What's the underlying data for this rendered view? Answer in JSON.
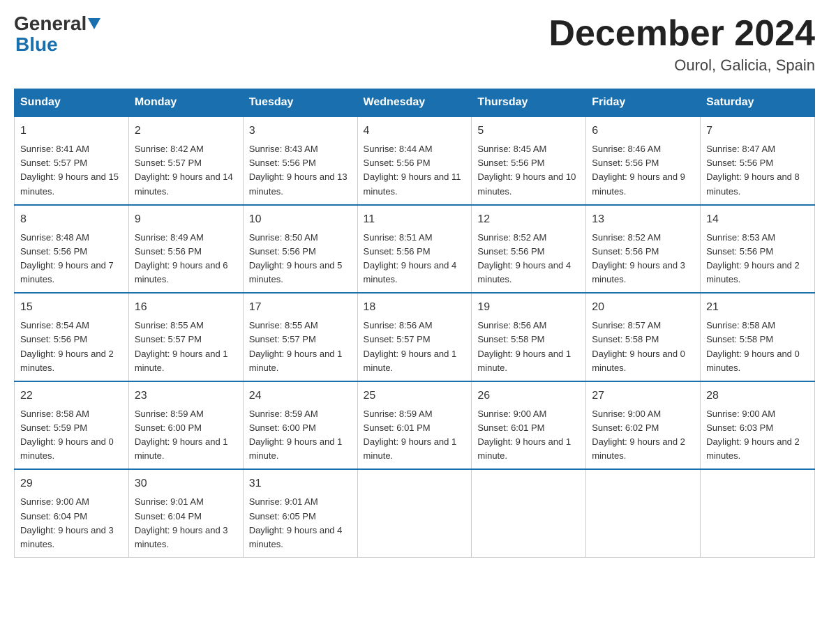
{
  "header": {
    "logo_general": "General",
    "logo_blue": "Blue",
    "month_title": "December 2024",
    "location": "Ourol, Galicia, Spain"
  },
  "weekdays": [
    "Sunday",
    "Monday",
    "Tuesday",
    "Wednesday",
    "Thursday",
    "Friday",
    "Saturday"
  ],
  "weeks": [
    [
      {
        "day": "1",
        "sunrise": "8:41 AM",
        "sunset": "5:57 PM",
        "daylight": "9 hours and 15 minutes."
      },
      {
        "day": "2",
        "sunrise": "8:42 AM",
        "sunset": "5:57 PM",
        "daylight": "9 hours and 14 minutes."
      },
      {
        "day": "3",
        "sunrise": "8:43 AM",
        "sunset": "5:56 PM",
        "daylight": "9 hours and 13 minutes."
      },
      {
        "day": "4",
        "sunrise": "8:44 AM",
        "sunset": "5:56 PM",
        "daylight": "9 hours and 11 minutes."
      },
      {
        "day": "5",
        "sunrise": "8:45 AM",
        "sunset": "5:56 PM",
        "daylight": "9 hours and 10 minutes."
      },
      {
        "day": "6",
        "sunrise": "8:46 AM",
        "sunset": "5:56 PM",
        "daylight": "9 hours and 9 minutes."
      },
      {
        "day": "7",
        "sunrise": "8:47 AM",
        "sunset": "5:56 PM",
        "daylight": "9 hours and 8 minutes."
      }
    ],
    [
      {
        "day": "8",
        "sunrise": "8:48 AM",
        "sunset": "5:56 PM",
        "daylight": "9 hours and 7 minutes."
      },
      {
        "day": "9",
        "sunrise": "8:49 AM",
        "sunset": "5:56 PM",
        "daylight": "9 hours and 6 minutes."
      },
      {
        "day": "10",
        "sunrise": "8:50 AM",
        "sunset": "5:56 PM",
        "daylight": "9 hours and 5 minutes."
      },
      {
        "day": "11",
        "sunrise": "8:51 AM",
        "sunset": "5:56 PM",
        "daylight": "9 hours and 4 minutes."
      },
      {
        "day": "12",
        "sunrise": "8:52 AM",
        "sunset": "5:56 PM",
        "daylight": "9 hours and 4 minutes."
      },
      {
        "day": "13",
        "sunrise": "8:52 AM",
        "sunset": "5:56 PM",
        "daylight": "9 hours and 3 minutes."
      },
      {
        "day": "14",
        "sunrise": "8:53 AM",
        "sunset": "5:56 PM",
        "daylight": "9 hours and 2 minutes."
      }
    ],
    [
      {
        "day": "15",
        "sunrise": "8:54 AM",
        "sunset": "5:56 PM",
        "daylight": "9 hours and 2 minutes."
      },
      {
        "day": "16",
        "sunrise": "8:55 AM",
        "sunset": "5:57 PM",
        "daylight": "9 hours and 1 minute."
      },
      {
        "day": "17",
        "sunrise": "8:55 AM",
        "sunset": "5:57 PM",
        "daylight": "9 hours and 1 minute."
      },
      {
        "day": "18",
        "sunrise": "8:56 AM",
        "sunset": "5:57 PM",
        "daylight": "9 hours and 1 minute."
      },
      {
        "day": "19",
        "sunrise": "8:56 AM",
        "sunset": "5:58 PM",
        "daylight": "9 hours and 1 minute."
      },
      {
        "day": "20",
        "sunrise": "8:57 AM",
        "sunset": "5:58 PM",
        "daylight": "9 hours and 0 minutes."
      },
      {
        "day": "21",
        "sunrise": "8:58 AM",
        "sunset": "5:58 PM",
        "daylight": "9 hours and 0 minutes."
      }
    ],
    [
      {
        "day": "22",
        "sunrise": "8:58 AM",
        "sunset": "5:59 PM",
        "daylight": "9 hours and 0 minutes."
      },
      {
        "day": "23",
        "sunrise": "8:59 AM",
        "sunset": "6:00 PM",
        "daylight": "9 hours and 1 minute."
      },
      {
        "day": "24",
        "sunrise": "8:59 AM",
        "sunset": "6:00 PM",
        "daylight": "9 hours and 1 minute."
      },
      {
        "day": "25",
        "sunrise": "8:59 AM",
        "sunset": "6:01 PM",
        "daylight": "9 hours and 1 minute."
      },
      {
        "day": "26",
        "sunrise": "9:00 AM",
        "sunset": "6:01 PM",
        "daylight": "9 hours and 1 minute."
      },
      {
        "day": "27",
        "sunrise": "9:00 AM",
        "sunset": "6:02 PM",
        "daylight": "9 hours and 2 minutes."
      },
      {
        "day": "28",
        "sunrise": "9:00 AM",
        "sunset": "6:03 PM",
        "daylight": "9 hours and 2 minutes."
      }
    ],
    [
      {
        "day": "29",
        "sunrise": "9:00 AM",
        "sunset": "6:04 PM",
        "daylight": "9 hours and 3 minutes."
      },
      {
        "day": "30",
        "sunrise": "9:01 AM",
        "sunset": "6:04 PM",
        "daylight": "9 hours and 3 minutes."
      },
      {
        "day": "31",
        "sunrise": "9:01 AM",
        "sunset": "6:05 PM",
        "daylight": "9 hours and 4 minutes."
      },
      null,
      null,
      null,
      null
    ]
  ]
}
